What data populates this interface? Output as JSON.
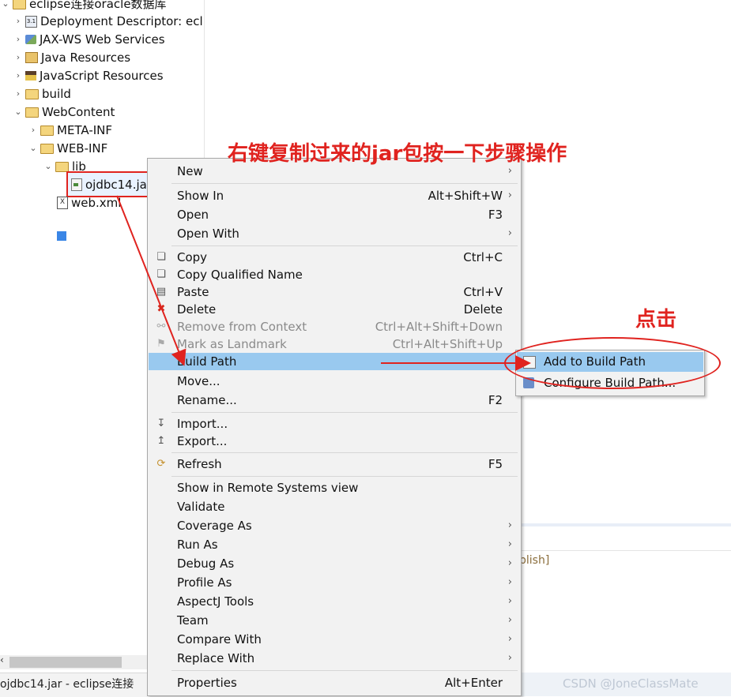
{
  "explorer": {
    "project": "eclipse连接oracle数据库",
    "items": [
      {
        "label": "Deployment Descriptor: ecl"
      },
      {
        "label": "JAX-WS Web Services"
      },
      {
        "label": "Java Resources"
      },
      {
        "label": "JavaScript Resources"
      },
      {
        "label": "build"
      },
      {
        "label": "WebContent"
      },
      {
        "label": "META-INF"
      },
      {
        "label": "WEB-INF"
      },
      {
        "label": "lib"
      },
      {
        "label": "ojdbc14.ja"
      },
      {
        "label": "web.xml"
      }
    ]
  },
  "menu": {
    "new": "New",
    "show_in": "Show In",
    "show_in_sc": "Alt+Shift+W",
    "open": "Open",
    "open_sc": "F3",
    "open_with": "Open With",
    "copy": "Copy",
    "copy_sc": "Ctrl+C",
    "copy_qualified": "Copy Qualified Name",
    "paste": "Paste",
    "paste_sc": "Ctrl+V",
    "delete": "Delete",
    "delete_sc": "Delete",
    "remove_context": "Remove from Context",
    "remove_context_sc": "Ctrl+Alt+Shift+Down",
    "mark_landmark": "Mark as Landmark",
    "mark_landmark_sc": "Ctrl+Alt+Shift+Up",
    "build_path": "Build Path",
    "move": "Move...",
    "rename": "Rename...",
    "rename_sc": "F2",
    "import": "Import...",
    "export": "Export...",
    "refresh": "Refresh",
    "refresh_sc": "F5",
    "show_remote": "Show in Remote Systems view",
    "validate": "Validate",
    "coverage_as": "Coverage As",
    "run_as": "Run As",
    "debug_as": "Debug As",
    "profile_as": "Profile As",
    "aspectj": "AspectJ Tools",
    "team": "Team",
    "compare_with": "Compare With",
    "replace_with": "Replace With",
    "properties": "Properties",
    "properties_sc": "Alt+Enter"
  },
  "submenu": {
    "add": "Add to Build Path",
    "configure": "Configure Build Path..."
  },
  "annotations": {
    "title": "右键复制过来的jar包按一下步骤操作",
    "click": "点击",
    "color": "#e0231f"
  },
  "right_panel": {
    "publish": "blish]"
  },
  "status": {
    "left": "ojdbc14.jar - eclipse连接",
    "watermark": "CSDN @JoneClassMate"
  },
  "colors": {
    "highlight": "#99c9ef",
    "menu_bg": "#f2f2f2"
  }
}
